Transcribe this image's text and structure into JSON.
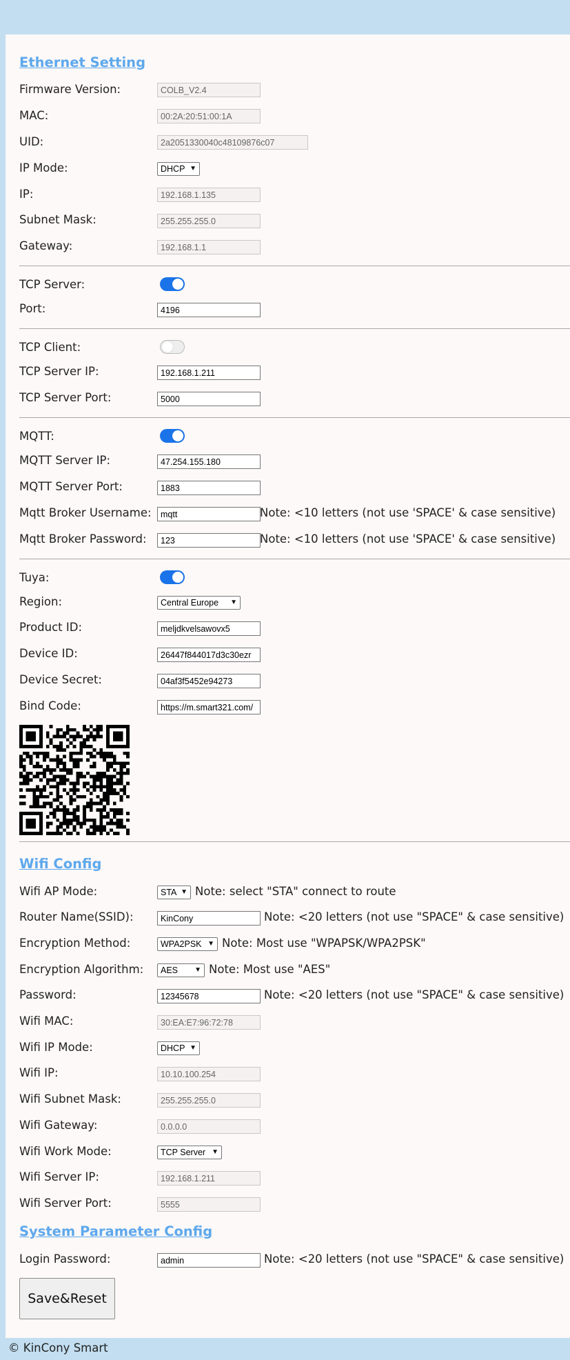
{
  "ethernet": {
    "title": "Ethernet Setting",
    "firmware": {
      "label": "Firmware Version:",
      "value": "COLB_V2.4"
    },
    "mac": {
      "label": "MAC:",
      "value": "00:2A:20:51:00:1A"
    },
    "uid": {
      "label": "UID:",
      "value": "2a2051330040c48109876c07"
    },
    "ip_mode": {
      "label": "IP Mode:",
      "value": "DHCP"
    },
    "ip": {
      "label": "IP:",
      "value": "192.168.1.135"
    },
    "subnet": {
      "label": "Subnet Mask:",
      "value": "255.255.255.0"
    },
    "gateway": {
      "label": "Gateway:",
      "value": "192.168.1.1"
    }
  },
  "tcp_server": {
    "label": "TCP Server:",
    "enabled": true,
    "port": {
      "label": "Port:",
      "value": "4196"
    }
  },
  "tcp_client": {
    "label": "TCP Client:",
    "enabled": false,
    "server_ip": {
      "label": "TCP Server IP:",
      "value": "192.168.1.211"
    },
    "server_port": {
      "label": "TCP Server Port:",
      "value": "5000"
    }
  },
  "mqtt": {
    "label": "MQTT:",
    "enabled": true,
    "server_ip": {
      "label": "MQTT Server IP:",
      "value": "47.254.155.180"
    },
    "server_port": {
      "label": "MQTT Server Port:",
      "value": "1883"
    },
    "username": {
      "label": "Mqtt Broker Username:",
      "value": "mqtt",
      "note": "Note: <10 letters (not use 'SPACE' & case sensitive)"
    },
    "password": {
      "label": "Mqtt Broker Password:",
      "value": "123",
      "note": "Note: <10 letters (not use 'SPACE' & case sensitive)"
    }
  },
  "tuya": {
    "label": "Tuya:",
    "enabled": true,
    "region": {
      "label": "Region:",
      "value": "Central Europe"
    },
    "product_id": {
      "label": "Product ID:",
      "value": "meljdkvelsawovx5"
    },
    "device_id": {
      "label": "Device ID:",
      "value": "26447f844017d3c30ezr"
    },
    "device_secret": {
      "label": "Device Secret:",
      "value": "04af3f5452e94273"
    },
    "bind_code": {
      "label": "Bind Code:",
      "value": "https://m.smart321.com/"
    }
  },
  "wifi": {
    "title": "Wifi Config",
    "ap_mode": {
      "label": "Wifi AP Mode:",
      "value": "STA",
      "note": "Note: select \"STA\" connect to route"
    },
    "ssid": {
      "label": "Router Name(SSID):",
      "value": "KinCony",
      "note": "Note: <20 letters (not use \"SPACE\" & case sensitive)"
    },
    "enc_method": {
      "label": "Encryption Method:",
      "value": "WPA2PSK",
      "note": "Note: Most use \"WPAPSK/WPA2PSK\""
    },
    "enc_algo": {
      "label": "Encryption Algorithm:",
      "value": "AES",
      "note": "Note: Most use \"AES\""
    },
    "password": {
      "label": "Password:",
      "value": "12345678",
      "note": "Note: <20 letters (not use \"SPACE\" & case sensitive)"
    },
    "mac": {
      "label": "Wifi MAC:",
      "value": "30:EA:E7:96:72:78"
    },
    "ip_mode": {
      "label": "Wifi IP Mode:",
      "value": "DHCP"
    },
    "ip": {
      "label": "Wifi IP:",
      "value": "10.10.100.254"
    },
    "subnet": {
      "label": "Wifi Subnet Mask:",
      "value": "255.255.255.0"
    },
    "gateway": {
      "label": "Wifi Gateway:",
      "value": "0.0.0.0"
    },
    "work_mode": {
      "label": "Wifi Work Mode:",
      "value": "TCP Server"
    },
    "server_ip": {
      "label": "Wifi Server IP:",
      "value": "192.168.1.211"
    },
    "server_port": {
      "label": "Wifi Server Port:",
      "value": "5555"
    }
  },
  "system": {
    "title": "System Parameter Config",
    "login_password": {
      "label": "Login Password:",
      "value": "admin",
      "note": "Note: <20 letters (not use \"SPACE\" & case sensitive)"
    }
  },
  "save_button": "Save&Reset",
  "footer": "© KinCony Smart",
  "colors": {
    "accent": "#5ea8ec",
    "toggle_on": "#1a73e8",
    "background": "#c2def0",
    "panel": "#fdf9f8"
  }
}
